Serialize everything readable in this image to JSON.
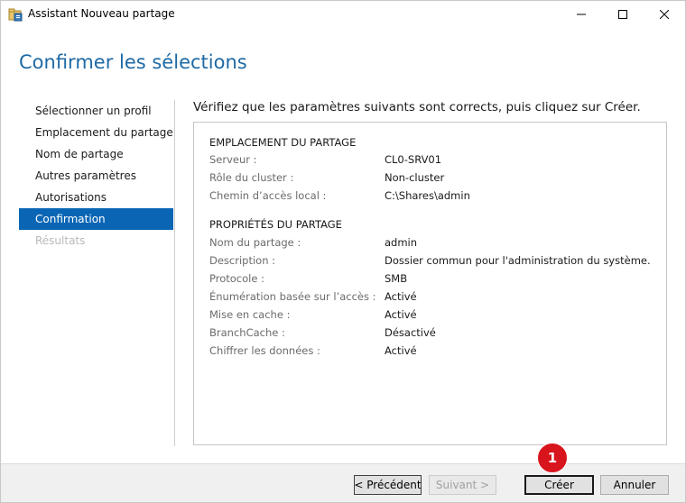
{
  "window": {
    "title": "Assistant Nouveau partage",
    "minimize_icon": "minimize-icon",
    "maximize_icon": "maximize-icon",
    "close_icon": "close-icon",
    "app_icon": "share-wizard-icon"
  },
  "page": {
    "title": "Confirmer les sélections",
    "instruction": "Vérifiez que les paramètres suivants sont corrects, puis cliquez sur Créer."
  },
  "sidebar": {
    "items": [
      {
        "label": "Sélectionner un profil",
        "state": "normal"
      },
      {
        "label": "Emplacement du partage",
        "state": "normal"
      },
      {
        "label": "Nom de partage",
        "state": "normal"
      },
      {
        "label": "Autres paramètres",
        "state": "normal"
      },
      {
        "label": "Autorisations",
        "state": "normal"
      },
      {
        "label": "Confirmation",
        "state": "active"
      },
      {
        "label": "Résultats",
        "state": "disabled"
      }
    ]
  },
  "summary": {
    "location": {
      "title": "EMPLACEMENT DU PARTAGE",
      "rows": [
        {
          "label": "Serveur :",
          "value": "CL0-SRV01"
        },
        {
          "label": "Rôle du cluster :",
          "value": "Non-cluster"
        },
        {
          "label": "Chemin d’accès local :",
          "value": "C:\\Shares\\admin"
        }
      ]
    },
    "properties": {
      "title": "PROPRIÉTÉS DU PARTAGE",
      "rows": [
        {
          "label": "Nom du partage :",
          "value": "admin"
        },
        {
          "label": "Description :",
          "value": "Dossier commun pour l'administration du système."
        },
        {
          "label": "Protocole :",
          "value": "SMB"
        },
        {
          "label": "Énumération basée sur l’accès :",
          "value": "Activé"
        },
        {
          "label": "Mise en cache :",
          "value": "Activé"
        },
        {
          "label": "BranchCache :",
          "value": "Désactivé"
        },
        {
          "label": "Chiffrer les données :",
          "value": "Activé"
        }
      ]
    }
  },
  "footer": {
    "previous_label": "< Précédent",
    "next_label": "Suivant >",
    "create_label": "Créer",
    "cancel_label": "Annuler"
  },
  "annotation": {
    "step_number": "1",
    "color": "#d8141c"
  },
  "colors": {
    "accent": "#0a66b5",
    "title": "#1f6aa5"
  }
}
